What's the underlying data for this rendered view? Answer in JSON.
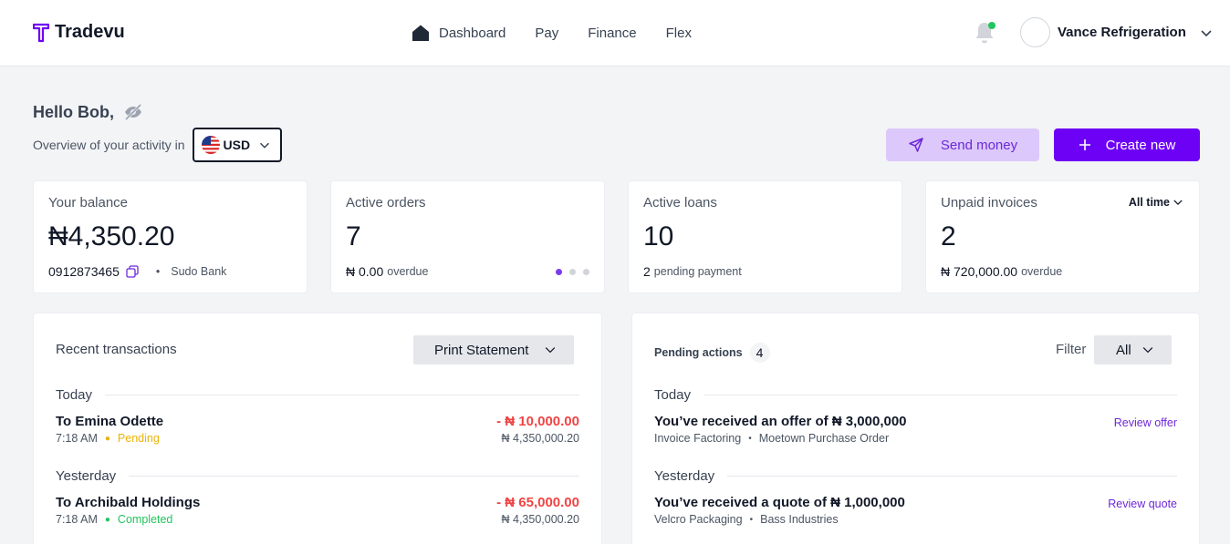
{
  "brand": {
    "name": "Tradevu",
    "accent": "#6d01f5"
  },
  "nav": {
    "items": [
      {
        "label": "Dashboard",
        "icon": "home-icon"
      },
      {
        "label": "Pay"
      },
      {
        "label": "Finance"
      },
      {
        "label": "Flex"
      }
    ]
  },
  "profile": {
    "name": "Vance Refrigeration",
    "notification_dot_color": "#22c55e"
  },
  "greeting": {
    "text": "Hello Bob,"
  },
  "overview": {
    "label": "Overview of your activity in",
    "currency": "USD"
  },
  "actions": {
    "send_label": "Send money",
    "create_label": "Create new"
  },
  "cards": {
    "balance": {
      "label": "Your balance",
      "value": "₦4,350.20",
      "account": "0912873465",
      "bank": "Sudo Bank"
    },
    "orders": {
      "label": "Active orders",
      "value": "7",
      "overdue_amount": "₦ 0.00",
      "overdue_label": "overdue",
      "carousel_active_index": 0,
      "carousel_count": 3
    },
    "loans": {
      "label": "Active loans",
      "value": "10",
      "pending_count": "2",
      "pending_label": "pending payment"
    },
    "invoices": {
      "label": "Unpaid invoices",
      "value": "2",
      "overdue_amount": "₦ 720,000.00",
      "overdue_label": "overdue",
      "period": "All time"
    }
  },
  "transactions": {
    "title": "Recent transactions",
    "print_label": "Print Statement",
    "groups": [
      {
        "label": "Today",
        "items": [
          {
            "title": "To Emina Odette",
            "time": "7:18 AM",
            "status": "Pending",
            "status_color": "#eab308",
            "amount": "- ₦ 10,000.00",
            "balance": "₦ 4,350,000.20"
          }
        ]
      },
      {
        "label": "Yesterday",
        "items": [
          {
            "title": "To Archibald Holdings",
            "time": "7:18 AM",
            "status": "Completed",
            "status_color": "#22c55e",
            "amount": "- ₦ 65,000.00",
            "balance": "₦ 4,350,000.20"
          }
        ]
      }
    ]
  },
  "pending": {
    "title": "Pending actions",
    "count": "4",
    "filter_label": "Filter",
    "filter_value": "All",
    "groups": [
      {
        "label": "Today",
        "items": [
          {
            "title": "You’ve received an offer of ₦ 3,000,000",
            "type": "Invoice Factoring",
            "source": "Moetown Purchase Order",
            "action": "Review offer"
          }
        ]
      },
      {
        "label": "Yesterday",
        "items": [
          {
            "title": "You’ve received a quote of ₦ 1,000,000",
            "type": "Velcro Packaging",
            "source": "Bass Industries",
            "action": "Review quote"
          }
        ]
      }
    ]
  }
}
